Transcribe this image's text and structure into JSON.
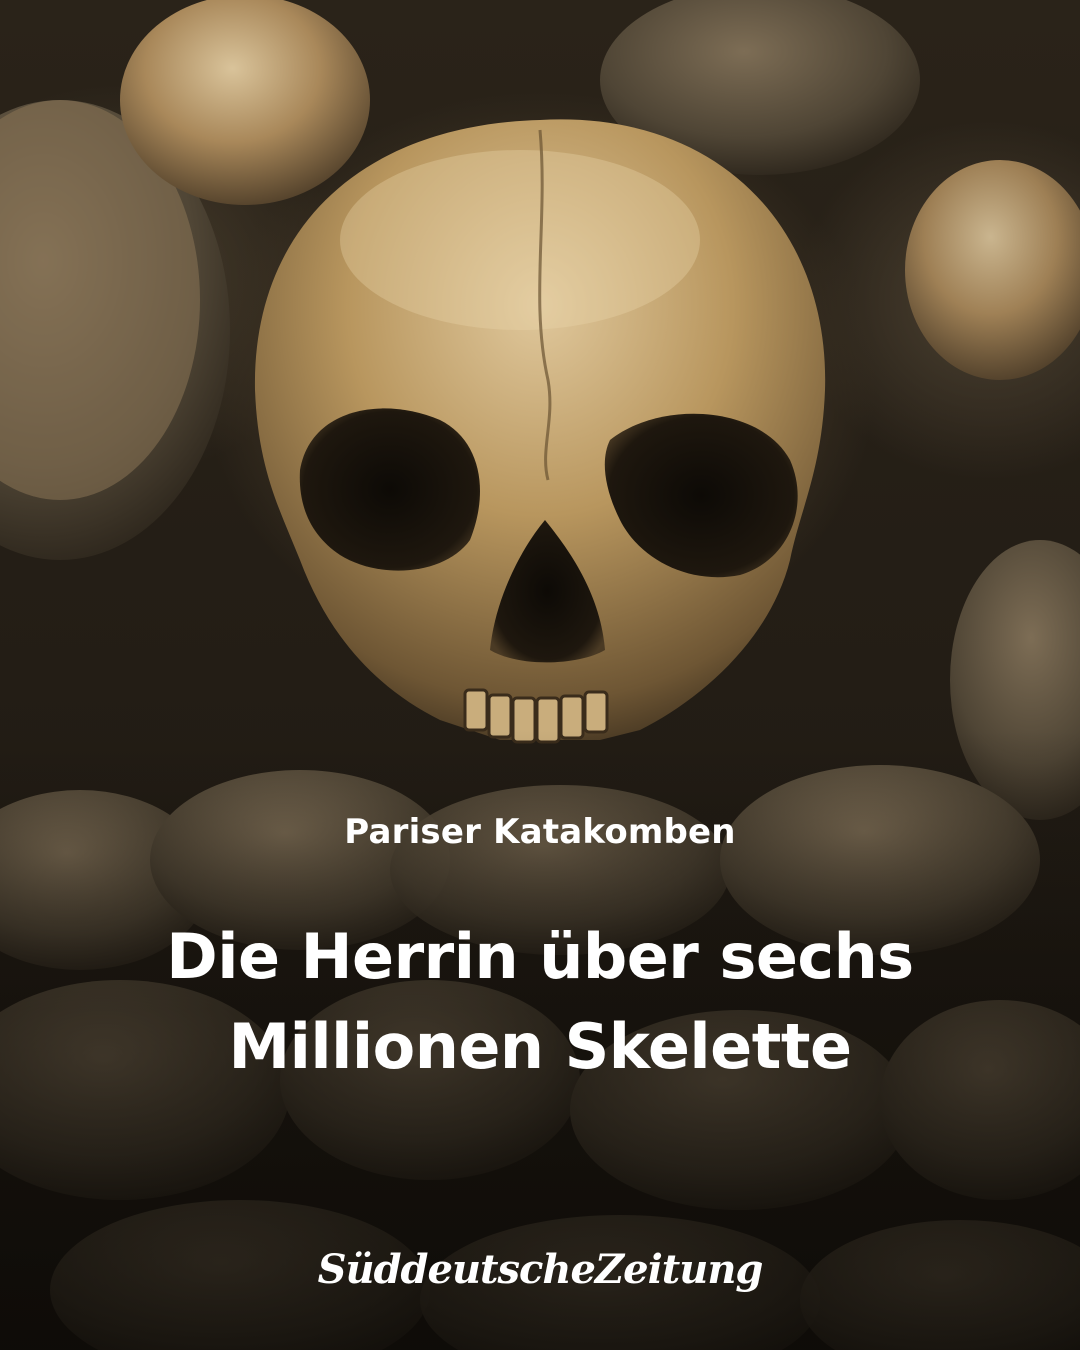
{
  "kicker": "Pariser Katakomben",
  "headline": "Die Herrin über sechs Millionen Skelette",
  "brand": "SüddeutscheZeitung",
  "colors": {
    "text": "#ffffff",
    "bone": "#b89a6a",
    "shadow": "#1f1a13"
  }
}
